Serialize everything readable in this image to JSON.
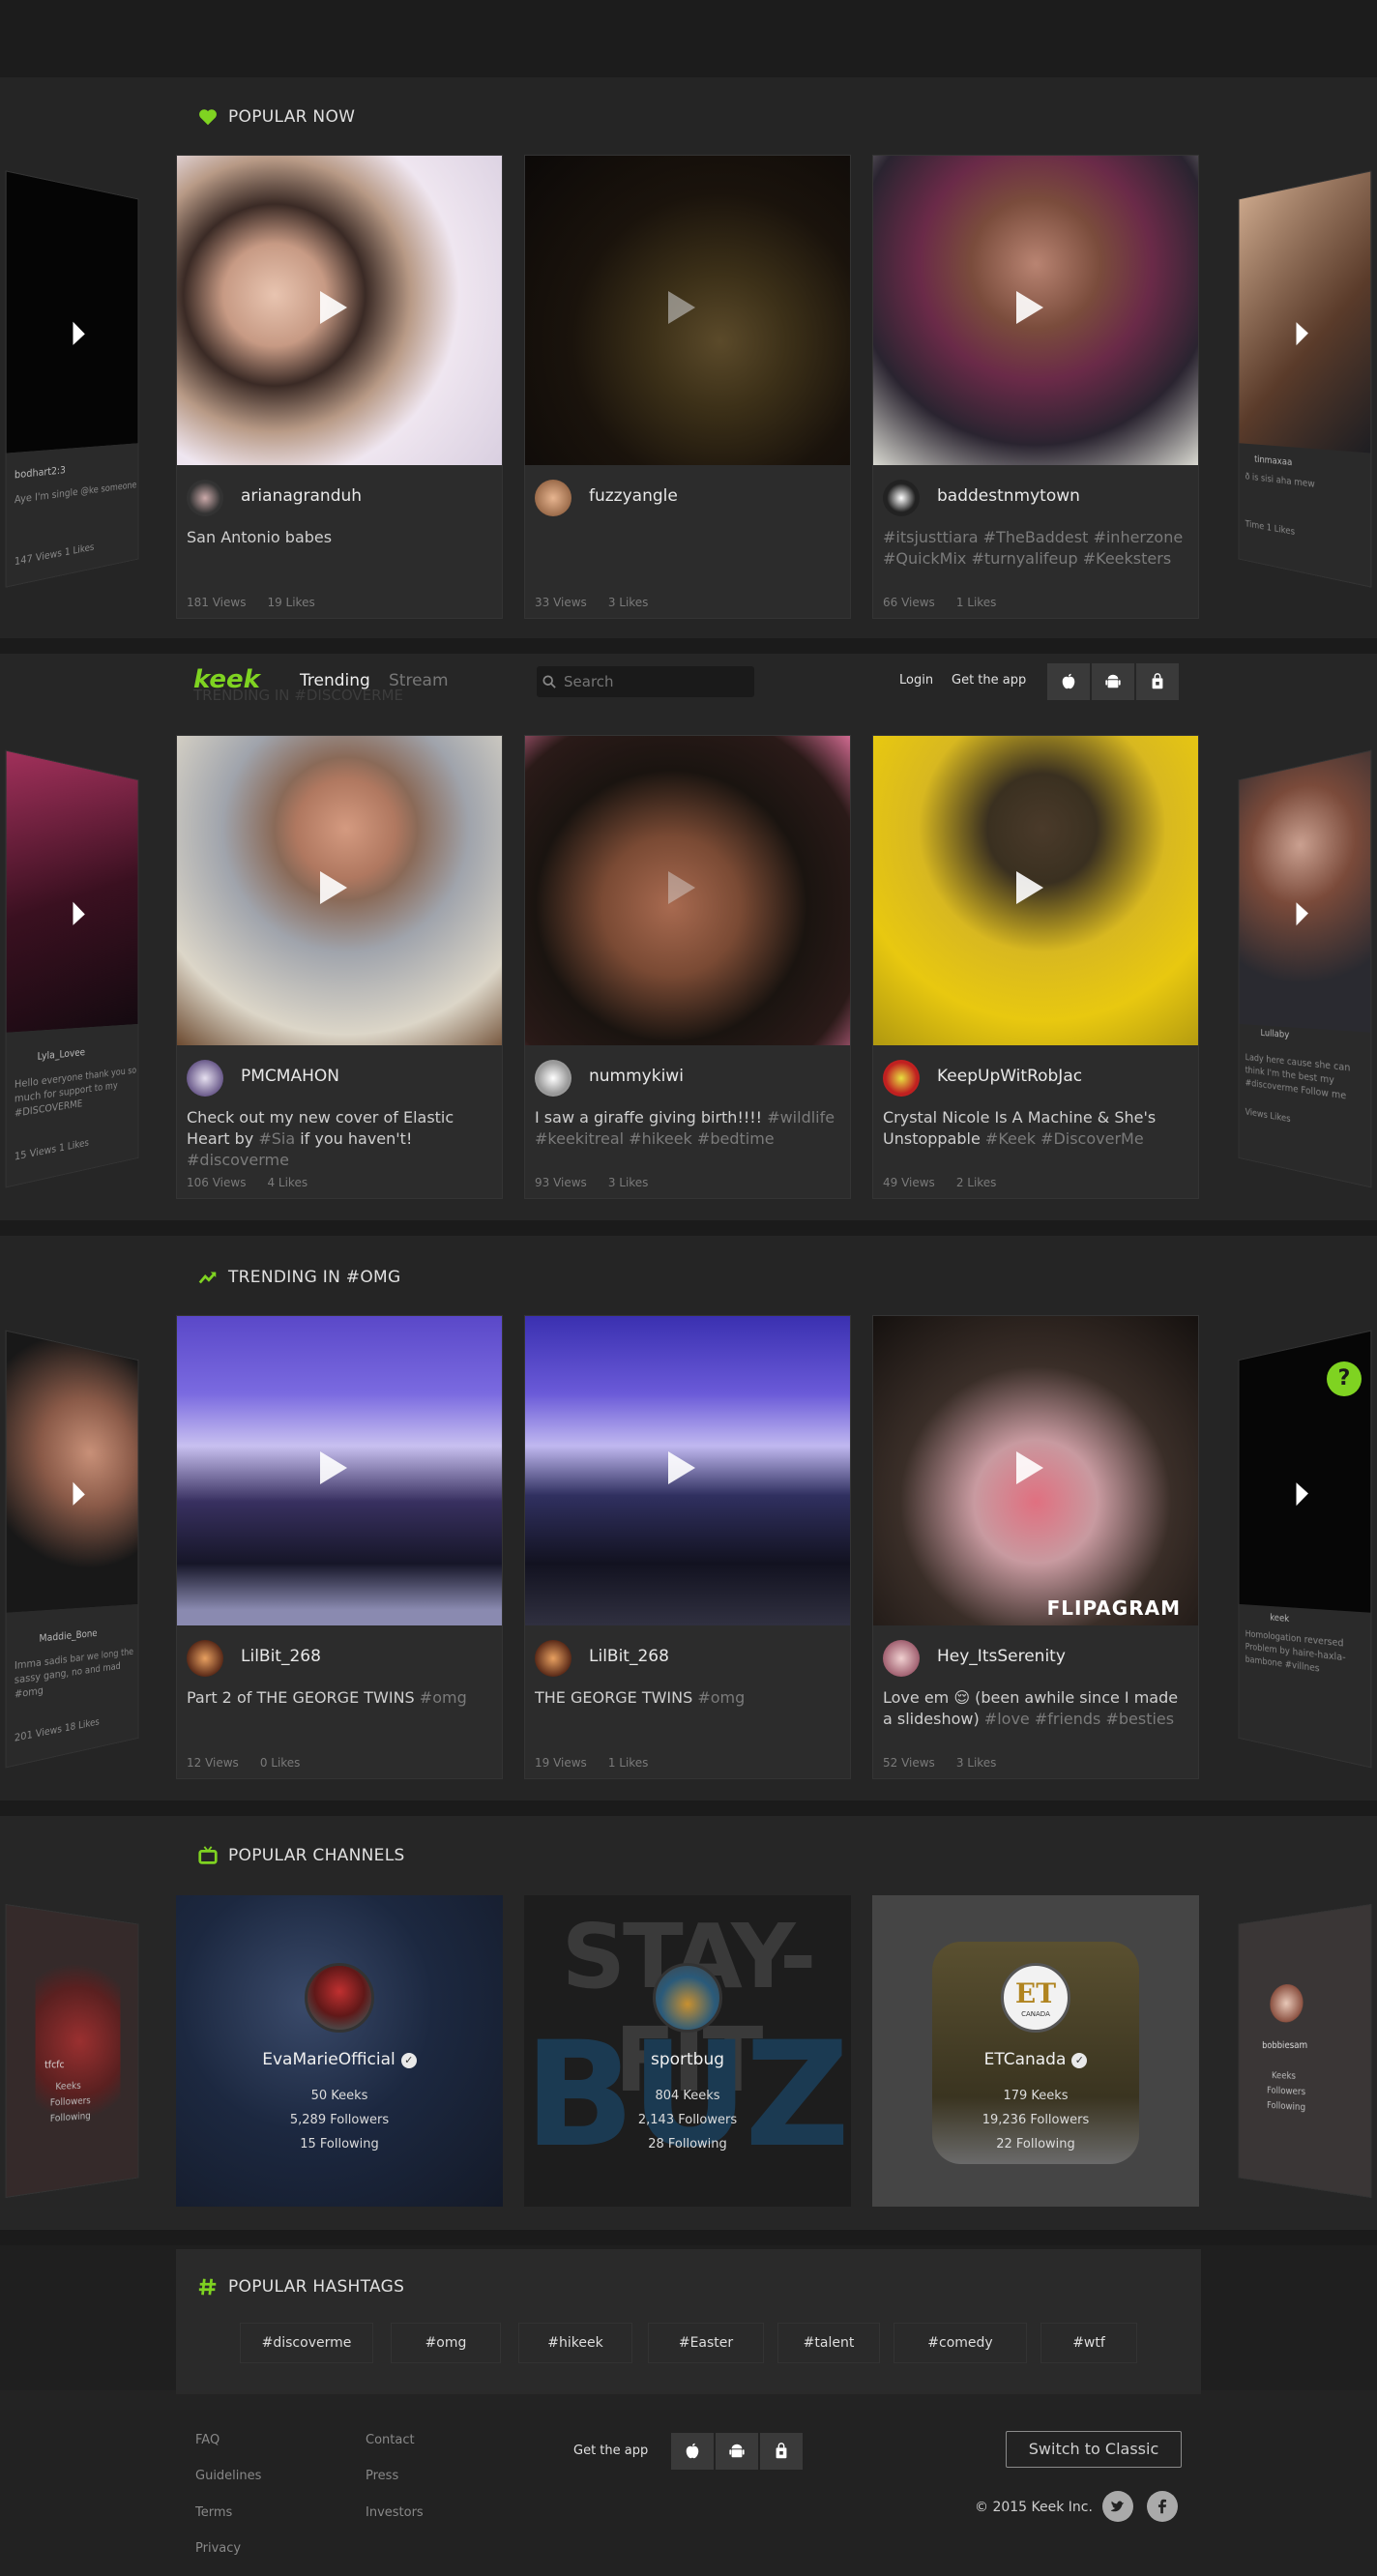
{
  "colors": {
    "accent": "#7fd321",
    "bg": "#232323",
    "card": "#2c2c2c"
  },
  "popular_now": {
    "title": "POPULAR NOW",
    "left_side": {
      "user": "bodhart2:3",
      "text": "Aye I'm single @ke someone",
      "stats": "147 Views   1 Likes"
    },
    "right_side": {
      "user": "tinmaxaa",
      "text": "ð is sisi aha mew",
      "stats": "Time   1 Likes"
    },
    "cards": [
      {
        "user": "arianagranduh",
        "caption": "San Antonio babes",
        "tags": "",
        "views": "181 Views",
        "likes": "19 Likes"
      },
      {
        "user": "fuzzyangle",
        "caption": "",
        "tags": "",
        "views": "33 Views",
        "likes": "3 Likes"
      },
      {
        "user": "baddestnmytown",
        "caption": "",
        "tags": "#itsjusttiara #TheBaddest #inherzone #QuickMix #turnyalifeup #Keeksters",
        "views": "66 Views",
        "likes": "1 Likes"
      }
    ]
  },
  "navbar": {
    "logo": "keek",
    "trending": "Trending",
    "stream": "Stream",
    "ghost": "TRENDING IN #DISCOVERME",
    "search_placeholder": "Search",
    "login": "Login",
    "get_app": "Get the app"
  },
  "discover": {
    "left_side": {
      "user": "Lyla_Lovee",
      "text": "Hello everyone thank you so much for support to my #DISCOVERME",
      "stats": "15 Views   1 Likes"
    },
    "right_side": {
      "user": "Lullaby",
      "text": "Lady here cause she can think I'm the best my #discoverme Follow me",
      "stats": "Views   Likes"
    },
    "cards": [
      {
        "user": "PMCMAHON",
        "caption": "Check out my new cover of Elastic Heart by ",
        "tags_mid": "#Sia",
        "caption2": " if you haven't! ",
        "tags": "#discoverme",
        "views": "106 Views",
        "likes": "4 Likes"
      },
      {
        "user": "nummykiwi",
        "caption": "I saw a giraffe giving birth!!!! ",
        "tags_mid": "",
        "caption2": "",
        "tags": "#wildlife #keekitreal #hikeek #bedtime",
        "views": "93 Views",
        "likes": "3 Likes"
      },
      {
        "user": "KeepUpWitRobJac",
        "caption": "Crystal Nicole Is A Machine & She's Unstoppable ",
        "tags_mid": "",
        "caption2": "",
        "tags": "#Keek #DiscoverMe",
        "views": "49 Views",
        "likes": "2 Likes"
      }
    ]
  },
  "trending_omg": {
    "title": "TRENDING IN #OMG",
    "left_side": {
      "user": "Maddie_Bone",
      "text": "Imma sadis bar we long the sassy gang, no and mad #omg",
      "stats": "201 Views   18 Likes"
    },
    "right_side": {
      "user": "keek",
      "text": "Homologation reversed Problem by haire-haxla-bambone #villnes",
      "stats": ""
    },
    "cards": [
      {
        "user": "LilBit_268",
        "caption": "Part 2 of THE GEORGE TWINS ",
        "tags": "#omg",
        "views": "12 Views",
        "likes": "0 Likes"
      },
      {
        "user": "LilBit_268",
        "caption": "THE GEORGE TWINS ",
        "tags": "#omg",
        "views": "19 Views",
        "likes": "1 Likes"
      },
      {
        "user": "Hey_ItsSerenity",
        "caption": "Love em 😌 (been awhile since I made a slideshow) ",
        "tags": "#love #friends #besties",
        "views": "52 Views",
        "likes": "3 Likes"
      }
    ],
    "flipagram": "FLIPAGRAM"
  },
  "popular_channels": {
    "title": "POPULAR CHANNELS",
    "left_side": {
      "name": "tfcfc",
      "stats": [
        "Keeks",
        "Followers",
        "Following"
      ]
    },
    "right_side": {
      "name": "bobbiesam",
      "stats": [
        "Keeks",
        "Followers",
        "Following"
      ]
    },
    "channels": [
      {
        "name": "EvaMarieOfficial",
        "keeks": "50 Keeks",
        "followers": "5,289 Followers",
        "following": "15 Following",
        "verified": true
      },
      {
        "name": "sportbug",
        "keeks": "804 Keeks",
        "followers": "2,143 Followers",
        "following": "28 Following",
        "verified": false
      },
      {
        "name": "ETCanada",
        "keeks": "179 Keeks",
        "followers": "19,236 Followers",
        "following": "22 Following",
        "verified": true
      }
    ],
    "staybuzz_top": "STAY-FIT",
    "staybuzz_bottom": "BUZZ",
    "et_logo": "ET",
    "et_sub": "CANADA"
  },
  "popular_hashtags": {
    "title": "POPULAR HASHTAGS",
    "tags": [
      "#discoverme",
      "#omg",
      "#hikeek",
      "#Easter",
      "#talent",
      "#comedy",
      "#wtf"
    ]
  },
  "footer": {
    "col1": [
      "FAQ",
      "Guidelines",
      "Terms",
      "Privacy"
    ],
    "col2": [
      "Contact",
      "Press",
      "Investors"
    ],
    "get_app": "Get the app",
    "switch": "Switch to Classic",
    "copyright": "© 2015 Keek Inc."
  },
  "help": "?"
}
